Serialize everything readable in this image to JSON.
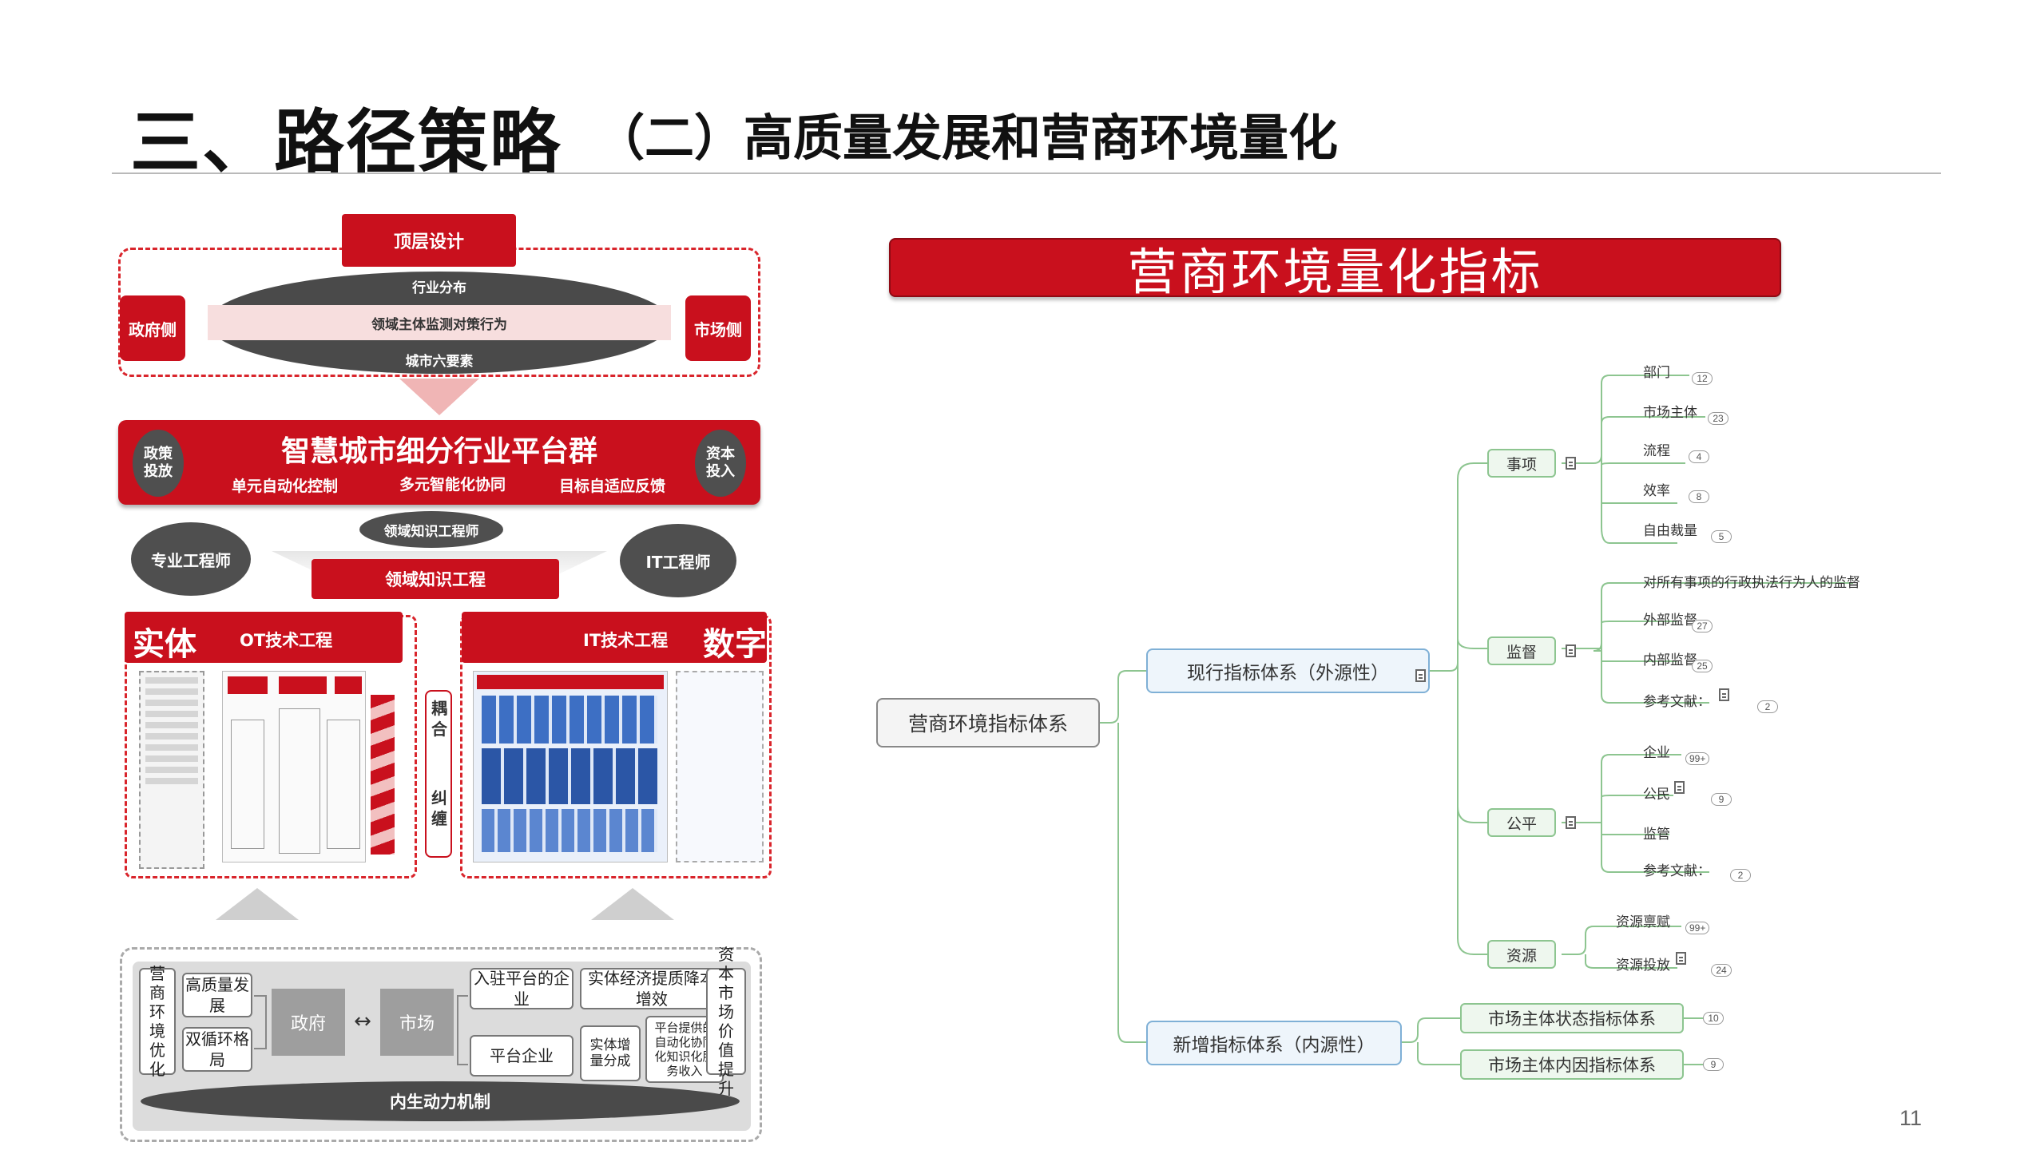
{
  "header": {
    "title_main": "三、路径策略",
    "title_sub": "（二）高质量发展和营商环境量化",
    "page_number": "11"
  },
  "left_diagram": {
    "top_design": "顶层设计",
    "gov_side": "政府侧",
    "market_side": "市场侧",
    "industry_dist": "行业分布",
    "domain_monitor": "领域主体监测对策行为",
    "city_six": "城市六要素",
    "platform_title": "智慧城市细分行业平台群",
    "policy_invest": "政策投放",
    "capital_invest": "资本投入",
    "unit_auto": "单元自动化控制",
    "multi_smart": "多元智能化协同",
    "target_adapt": "目标自适应反馈",
    "domain_engineer": "领域知识工程师",
    "pro_engineer": "专业工程师",
    "it_engineer": "IT工程师",
    "domain_eng": "领域知识工程",
    "entity": "实体",
    "ot_tech": "OT技术工程",
    "it_tech": "IT技术工程",
    "digital": "数字",
    "coupling": "耦合",
    "entangle": "纠缠",
    "bottom": {
      "business_env": "营商环境优化",
      "high_quality": "高质量发展",
      "dual_cycle": "双循环格局",
      "government": "政府",
      "market": "市场",
      "arrow": "↔",
      "settled_enterprise": "入驻平台的企业",
      "cost_reduce": "实体经济提质降本增效",
      "platform_enterprise": "平台企业",
      "entity_share": "实体增量分成",
      "platform_service": "平台提供的自动化协同化知识化服务收入",
      "capital_value": "资本市场价值提升",
      "endogenous": "内生动力机制"
    }
  },
  "mind_map": {
    "banner": "营商环境量化指标",
    "root": "营商环境指标体系",
    "branch_existing": "现行指标体系（外源性）",
    "branch_new": "新增指标体系（内源性）",
    "groups": [
      {
        "label": "事项",
        "leaves": [
          {
            "label": "部门",
            "count": "12"
          },
          {
            "label": "市场主体",
            "count": "23"
          },
          {
            "label": "流程",
            "count": "4"
          },
          {
            "label": "效率",
            "count": "8"
          },
          {
            "label": "自由裁量",
            "count": "5"
          }
        ]
      },
      {
        "label": "监督",
        "leaves": [
          {
            "label": "对所有事项的行政执法行为人的监督",
            "count": ""
          },
          {
            "label": "外部监督",
            "count": "27"
          },
          {
            "label": "内部监督",
            "count": "25"
          },
          {
            "label": "参考文献：",
            "count": "2"
          }
        ]
      },
      {
        "label": "公平",
        "leaves": [
          {
            "label": "企业",
            "count": "99+"
          },
          {
            "label": "公民",
            "count": "9"
          },
          {
            "label": "监管",
            "count": ""
          },
          {
            "label": "参考文献：",
            "count": "2"
          }
        ]
      },
      {
        "label": "资源",
        "leaves": [
          {
            "label": "资源禀赋",
            "count": "99+"
          },
          {
            "label": "资源投放",
            "count": "24"
          }
        ]
      }
    ],
    "new_items": [
      {
        "label": "市场主体状态指标体系",
        "count": "10"
      },
      {
        "label": "市场主体内因指标体系",
        "count": "9"
      }
    ]
  }
}
